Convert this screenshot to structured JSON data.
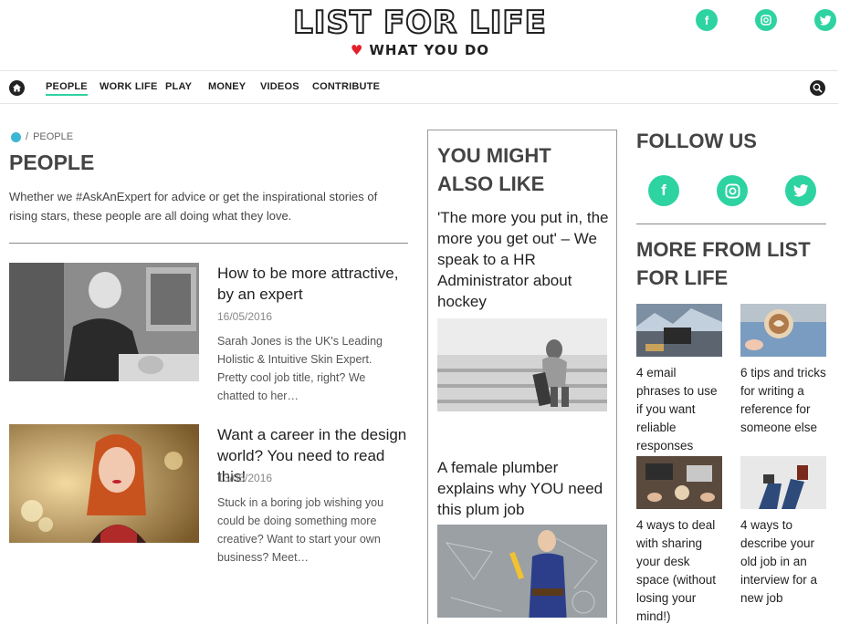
{
  "header": {
    "logo_title": "LIST FOR LIFE",
    "logo_tagline": "WHAT YOU DO",
    "social": [
      "facebook-icon",
      "instagram-icon",
      "twitter-icon"
    ]
  },
  "nav": {
    "items": [
      {
        "label": "PEOPLE",
        "active": true
      },
      {
        "label": "WORK LIFE"
      },
      {
        "label": "PLAY"
      },
      {
        "label": "MONEY"
      },
      {
        "label": "VIDEOS"
      },
      {
        "label": "CONTRIBUTE"
      }
    ]
  },
  "breadcrumb": {
    "separator": "/",
    "current": "PEOPLE"
  },
  "page": {
    "title": "PEOPLE",
    "intro": "Whether we #AskAnExpert for advice or get the inspirational stories of rising stars, these people are all doing what they love."
  },
  "articles": [
    {
      "title": "How to be more attractive, by an expert",
      "date": "16/05/2016",
      "excerpt": "Sarah Jones is the UK's Leading Holistic & Intuitive Skin Expert. Pretty cool job title, right? We chatted to her…"
    },
    {
      "title": "Want a career in the design world? You need to read this!",
      "date": "13/05/2016",
      "excerpt": "Stuck in a boring job wishing you could be doing something more creative? Want to start your own business? Meet…"
    }
  ],
  "might_like": {
    "heading": "YOU MIGHT ALSO LIKE",
    "items": [
      {
        "title": "'The more you put in, the more you get out' – We speak to a HR Administrator about hockey"
      },
      {
        "title": "A female plumber explains why YOU need this plum job"
      }
    ]
  },
  "follow": {
    "heading": "FOLLOW US"
  },
  "more_from": {
    "heading": "MORE FROM LIST FOR LIFE",
    "items": [
      {
        "title": "4 email phrases to use if you want reliable responses"
      },
      {
        "title": "6 tips and tricks for writing a reference for someone else"
      },
      {
        "title": "4 ways to deal with sharing your desk space (without losing your mind!)"
      },
      {
        "title": "4 ways to describe your old job in an interview for a new job"
      }
    ]
  },
  "colors": {
    "accent": "#2ed3a2",
    "heart": "#e3202a",
    "text": "#333333"
  }
}
